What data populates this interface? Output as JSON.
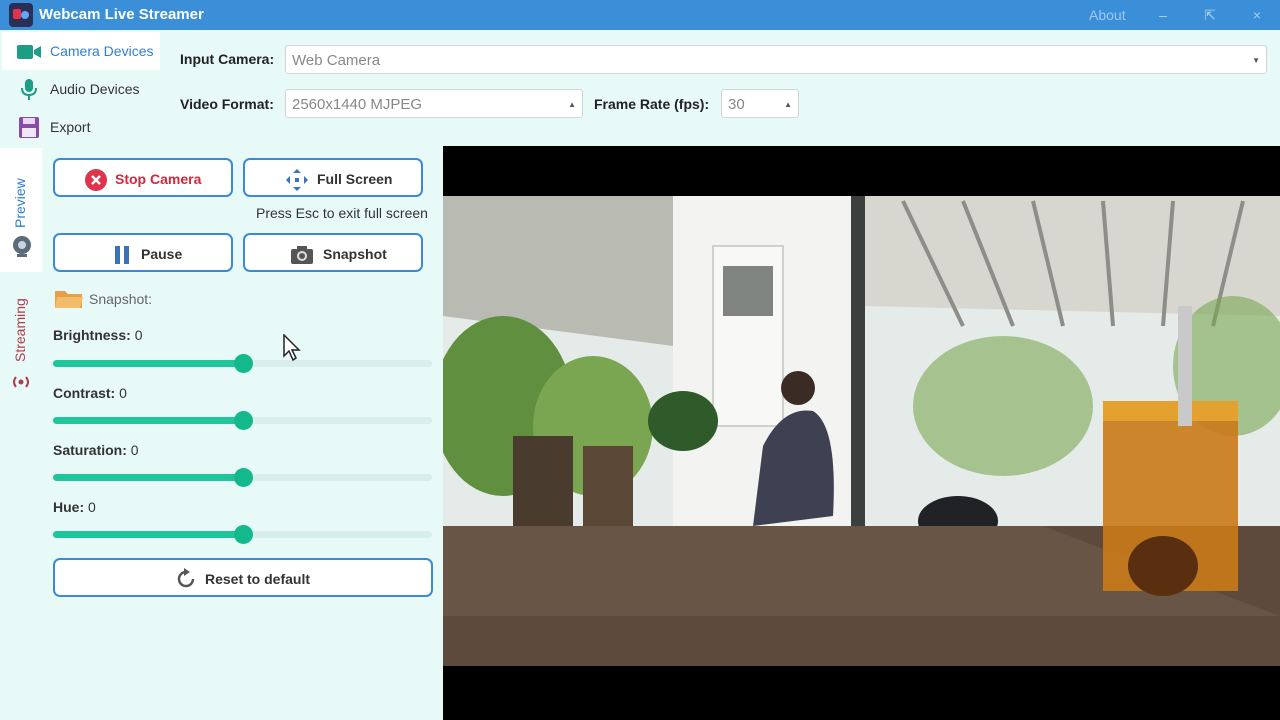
{
  "window": {
    "title": "Webcam Live Streamer",
    "about_label": "About",
    "minimize_label": "–",
    "pin_label": "⇱",
    "close_label": "×"
  },
  "nav": {
    "items": [
      {
        "label": "Camera Devices",
        "icon": "camera-icon",
        "active": true
      },
      {
        "label": "Audio Devices",
        "icon": "microphone-icon",
        "active": false
      },
      {
        "label": "Export",
        "icon": "floppy-disk-icon",
        "active": false
      }
    ]
  },
  "camera": {
    "input_label": "Input Camera:",
    "input_value": "Web Camera",
    "format_label": "Video Format:",
    "format_value": "2560x1440 MJPEG",
    "framerate_label": "Frame Rate (fps):",
    "framerate_value": "30"
  },
  "side_tabs": {
    "preview": "Preview",
    "streaming": "Streaming"
  },
  "controls": {
    "stop_camera": "Stop Camera",
    "full_screen": "Full Screen",
    "fullscreen_hint": "Press Esc to exit full screen",
    "pause": "Pause",
    "snapshot": "Snapshot",
    "snapshot_folder_label": "Snapshot:",
    "reset": "Reset to default"
  },
  "adjustments": [
    {
      "name": "Brightness:",
      "value": "0",
      "level": 0.5
    },
    {
      "name": "Contrast:",
      "value": "0",
      "level": 0.5
    },
    {
      "name": "Saturation:",
      "value": "0",
      "level": 0.5
    },
    {
      "name": "Hue:",
      "value": "0",
      "level": 0.5
    }
  ],
  "colors": {
    "titlebar": "#3b8fd9",
    "accent_green": "#1fc59b",
    "button_border": "#3a8ad8",
    "stop_red": "#e0344a",
    "panel_bg": "#e8faf7"
  }
}
